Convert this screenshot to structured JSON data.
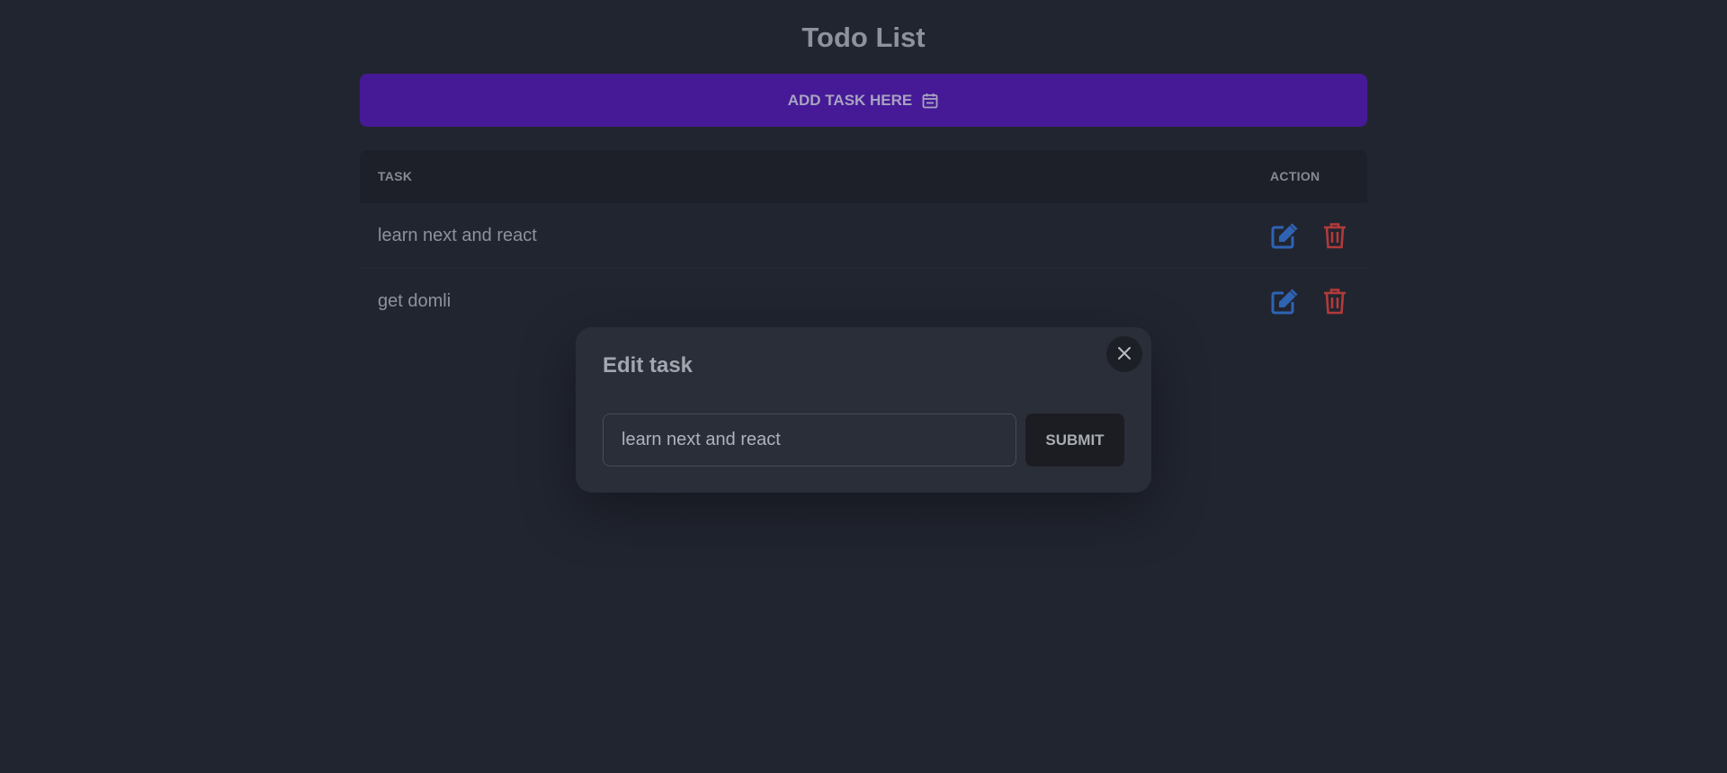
{
  "page": {
    "title": "Todo List",
    "add_button_label": "ADD TASK HERE",
    "add_button_icon": "calendar-icon"
  },
  "table": {
    "headers": {
      "task": "TASK",
      "action": "ACTION"
    },
    "rows": [
      {
        "task": "learn next and react"
      },
      {
        "task": "get domli"
      }
    ],
    "row_icons": {
      "edit": "edit-icon",
      "delete": "trash-icon"
    }
  },
  "modal": {
    "title": "Edit task",
    "input_value": "learn next and react",
    "submit_label": "SUBMIT",
    "close_icon": "close-icon"
  },
  "colors": {
    "background": "#212530",
    "accent": "#461a96",
    "edit": "#2f63b3",
    "delete": "#b33a3a",
    "modal_bg": "#2a2e39"
  }
}
